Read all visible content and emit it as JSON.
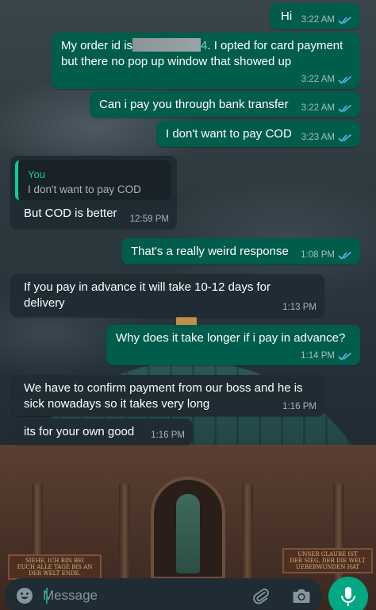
{
  "colors": {
    "outgoing_bubble": "#005c4b",
    "incoming_bubble": "#1f2c33",
    "read_ticks": "#53bdeb",
    "accent": "#00a884",
    "quote_accent": "#06cf9c"
  },
  "messages": [
    {
      "id": "m1",
      "direction": "outgoing",
      "text": "Hi",
      "time": "3:22 AM",
      "status": "read"
    },
    {
      "id": "m2",
      "direction": "outgoing",
      "text_before": "My order id is",
      "text_redacted_suffix": "4",
      "text_after": ". I opted for card payment\nbut there no pop up window that showed up",
      "time": "3:22 AM",
      "status": "read"
    },
    {
      "id": "m3",
      "direction": "outgoing",
      "text": "Can i pay you through bank transfer",
      "time": "3:22 AM",
      "status": "read"
    },
    {
      "id": "m4",
      "direction": "outgoing",
      "text": "I don't want to pay COD",
      "time": "3:23 AM",
      "status": "read"
    },
    {
      "id": "m5",
      "direction": "incoming",
      "quote_author": "You",
      "quote_text": "I don't want to pay COD",
      "text": "But COD is better",
      "time": "12:59 PM"
    },
    {
      "id": "m6",
      "direction": "outgoing",
      "text": "That's a really weird response",
      "time": "1:08 PM",
      "status": "read"
    },
    {
      "id": "m7",
      "direction": "incoming",
      "text": "If you pay in advance it will take 10-12 days for\ndelivery",
      "time": "1:13 PM"
    },
    {
      "id": "m8",
      "direction": "outgoing",
      "text": "Why does it take longer if i pay in advance?",
      "time": "1:14 PM",
      "status": "read"
    },
    {
      "id": "m9",
      "direction": "incoming",
      "text": "We have to confirm payment from our boss and he is\nsick nowadays so it takes very long",
      "time": "1:16 PM"
    },
    {
      "id": "m10",
      "direction": "incoming",
      "text": "its for your own good",
      "time": "1:16 PM"
    }
  ],
  "wallpaper": {
    "plaque_left": "SIEHE, ICH BIN BEI\nEUCH ALLE TAGE BIS AN\nDER WELT ENDE.",
    "plaque_right": "UNSER GLAUBE IST\nDER SIEG, DER DIE WELT\nUEBERWUNDEN HAT"
  },
  "composer": {
    "placeholder": "Message",
    "emoji_icon": "emoji-icon",
    "attach_icon": "paperclip-icon",
    "camera_icon": "camera-icon",
    "mic_icon": "microphone-icon"
  }
}
